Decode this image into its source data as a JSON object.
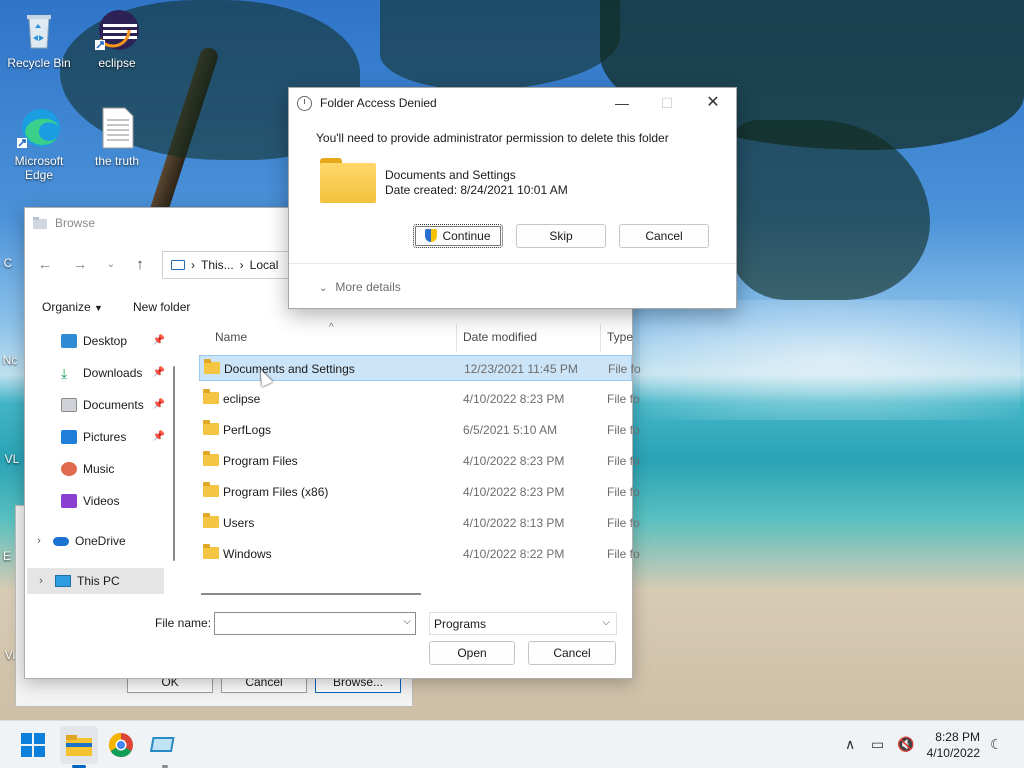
{
  "desktop": {
    "icons": [
      {
        "label": "Recycle Bin"
      },
      {
        "label": "eclipse"
      },
      {
        "label": "Microsoft Edge"
      },
      {
        "label": "the truth"
      }
    ],
    "partial_labels": [
      "C",
      "Nc",
      "VL",
      "E",
      "Vi"
    ]
  },
  "background_dialog": {
    "buttons": [
      "OK",
      "Cancel",
      "Browse..."
    ]
  },
  "browse": {
    "title": "Browse",
    "address": {
      "segments": [
        "This...",
        "Local"
      ]
    },
    "toolbar": {
      "organize": "Organize",
      "new_folder": "New folder"
    },
    "sidebar": {
      "quick_access": [
        {
          "label": "Desktop",
          "pinned": true,
          "color": "#2e8bd4"
        },
        {
          "label": "Downloads",
          "pinned": true,
          "color": "#1e9e55"
        },
        {
          "label": "Documents",
          "pinned": true,
          "color": "#8a8a8a"
        },
        {
          "label": "Pictures",
          "pinned": true,
          "color": "#1f7fd8"
        },
        {
          "label": "Music",
          "pinned": false,
          "color": "#e06a4d"
        },
        {
          "label": "Videos",
          "pinned": false,
          "color": "#8a3fd1"
        }
      ],
      "tree": [
        {
          "label": "OneDrive"
        },
        {
          "label": "This PC"
        }
      ]
    },
    "columns": {
      "name": "Name",
      "date": "Date modified",
      "type": "Type"
    },
    "rows": [
      {
        "name": "Documents and Settings",
        "date": "12/23/2021 11:45 PM",
        "type": "File fo"
      },
      {
        "name": "eclipse",
        "date": "4/10/2022 8:23 PM",
        "type": "File fo"
      },
      {
        "name": "PerfLogs",
        "date": "6/5/2021 5:10 AM",
        "type": "File fo"
      },
      {
        "name": "Program Files",
        "date": "4/10/2022 8:23 PM",
        "type": "File fo"
      },
      {
        "name": "Program Files (x86)",
        "date": "4/10/2022 8:23 PM",
        "type": "File fo"
      },
      {
        "name": "Users",
        "date": "4/10/2022 8:13 PM",
        "type": "File fo"
      },
      {
        "name": "Windows",
        "date": "4/10/2022 8:22 PM",
        "type": "File fo"
      }
    ],
    "file_name_label": "File name:",
    "file_name_value": "",
    "filter_value": "Programs",
    "open_label": "Open",
    "cancel_label": "Cancel"
  },
  "access_dialog": {
    "title": "Folder Access Denied",
    "message": "You'll need to provide administrator permission to delete this folder",
    "folder_name": "Documents and Settings",
    "date_created": "Date created: 8/24/2021 10:01 AM",
    "continue_label": "Continue",
    "skip_label": "Skip",
    "cancel_label": "Cancel",
    "more_details": "More details"
  },
  "taskbar": {
    "time": "8:28 PM",
    "date": "4/10/2022"
  }
}
